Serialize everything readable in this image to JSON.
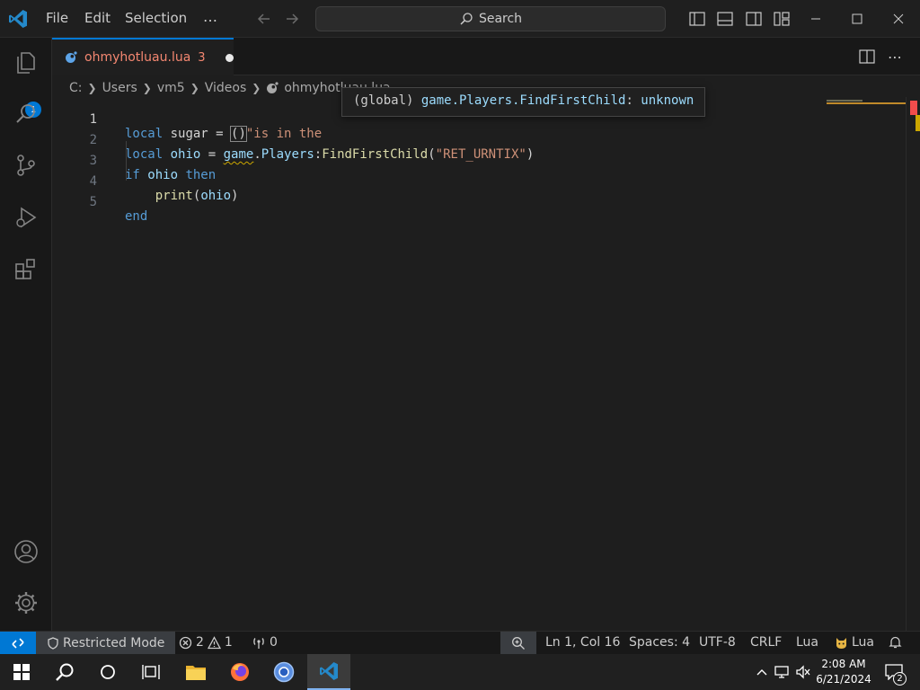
{
  "titlebar": {
    "menu": [
      "File",
      "Edit",
      "Selection"
    ],
    "more": "…",
    "search_placeholder": "Search"
  },
  "activity": {
    "explorer_badge": "1"
  },
  "tab": {
    "filename": "ohmyhotluau.lua",
    "error_count": "3"
  },
  "breadcrumb": {
    "items": [
      "C:",
      "Users",
      "vm5",
      "Videos",
      "ohmyhotluau.lua"
    ]
  },
  "editor": {
    "lines": [
      {
        "num": "1",
        "tokens": [
          {
            "t": "local",
            "c": "kw"
          },
          {
            "t": " sugar = ",
            "c": "op"
          },
          {
            "t": "()",
            "c": "op"
          },
          {
            "t": "\"is in the",
            "c": "str"
          }
        ]
      },
      {
        "num": "2",
        "tokens": [
          {
            "t": "local",
            "c": "kw"
          },
          {
            "t": " ",
            "c": "op"
          },
          {
            "t": "ohio",
            "c": "var"
          },
          {
            "t": " = ",
            "c": "op"
          },
          {
            "t": "game",
            "c": "var"
          },
          {
            "t": ".",
            "c": "op"
          },
          {
            "t": "Players",
            "c": "var"
          },
          {
            "t": ":",
            "c": "op"
          },
          {
            "t": "FindFirstChild",
            "c": "fn"
          },
          {
            "t": "(",
            "c": "op"
          },
          {
            "t": "\"RET_URNTIX\"",
            "c": "str"
          },
          {
            "t": ")",
            "c": "op"
          }
        ]
      },
      {
        "num": "3",
        "tokens": [
          {
            "t": "if",
            "c": "kw"
          },
          {
            "t": " ",
            "c": "op"
          },
          {
            "t": "ohio",
            "c": "var"
          },
          {
            "t": " ",
            "c": "op"
          },
          {
            "t": "then",
            "c": "kw"
          }
        ]
      },
      {
        "num": "4",
        "tokens": [
          {
            "t": "    ",
            "c": "op"
          },
          {
            "t": "print",
            "c": "fn"
          },
          {
            "t": "(",
            "c": "op"
          },
          {
            "t": "ohio",
            "c": "var"
          },
          {
            "t": ")",
            "c": "op"
          }
        ]
      },
      {
        "num": "5",
        "tokens": [
          {
            "t": "end",
            "c": "kw"
          }
        ]
      }
    ],
    "active_line": "1"
  },
  "hover": {
    "prefix": "(global) ",
    "name": "game.Players.FindFirstChild",
    "sep": ": ",
    "type": "unknown"
  },
  "statusbar": {
    "restricted": "Restricted Mode",
    "errors": "2",
    "warnings": "1",
    "ports": "0",
    "position": "Ln 1, Col 16",
    "spaces": "Spaces: 4",
    "encoding": "UTF-8",
    "eol": "CRLF",
    "language": "Lua",
    "lua_ext": "Lua"
  },
  "taskbar": {
    "time": "2:08 AM",
    "date": "6/21/2024",
    "notifications": "2"
  },
  "colors": {
    "accent": "#0078d4",
    "error": "#f48771",
    "keyword": "#569cd6",
    "string": "#ce9178"
  }
}
